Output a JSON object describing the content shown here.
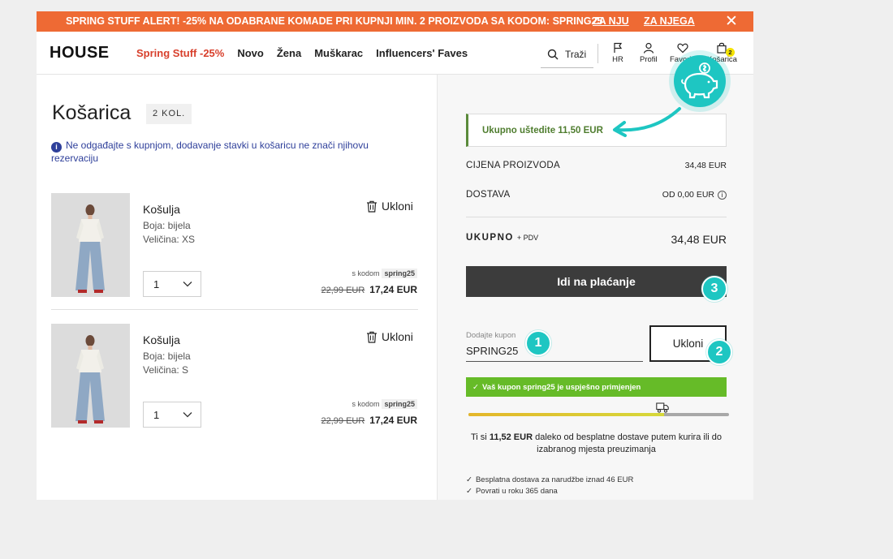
{
  "promo": {
    "text": "SPRING STUFF ALERT! -25% NA ODABRANE KOMADE PRI KUPNJI MIN. 2 PROIZVODA SA KODOM: SPRING25",
    "link_her": "ZA NJU",
    "link_him": "ZA NJEGA",
    "close": "✕"
  },
  "header": {
    "logo": "HOUSE",
    "nav": [
      "Spring Stuff -25%",
      "Novo",
      "Žena",
      "Muškarac",
      "Influencers' Faves"
    ],
    "search_placeholder": "Traži",
    "icons": {
      "lang": "HR",
      "profile": "Profil",
      "favorites": "Favoriti",
      "cart": "Košarica",
      "cart_count": "2"
    }
  },
  "cart": {
    "title": "Košarica",
    "count_badge": "2 KOL.",
    "notice": "Ne odgađajte s kupnjom, dodavanje stavki u košaricu ne znači njihovu rezervaciju",
    "items": [
      {
        "name": "Košulja",
        "color": "Boja: bijela",
        "size": "Veličina: XS",
        "qty": "1",
        "remove": "Ukloni",
        "code_prefix": "s kodom",
        "code": "spring25",
        "old_price": "22,99 EUR",
        "new_price": "17,24 EUR"
      },
      {
        "name": "Košulja",
        "color": "Boja: bijela",
        "size": "Veličina: S",
        "qty": "1",
        "remove": "Ukloni",
        "code_prefix": "s kodom",
        "code": "spring25",
        "old_price": "22,99 EUR",
        "new_price": "17,24 EUR"
      }
    ]
  },
  "summary": {
    "savings": "Ukupno uštedite 11,50 EUR",
    "product_price_label": "CIJENA PROIZVODA",
    "product_price": "34,48 EUR",
    "delivery_label": "DOSTAVA",
    "delivery": "OD 0,00 EUR",
    "total_label": "UKUPNO",
    "total_suffix": "+ PDV",
    "total": "34,48 EUR",
    "checkout": "Idi na plaćanje",
    "coupon_label": "Dodajte kupon",
    "coupon_value": "SPRING25",
    "coupon_remove": "Ukloni",
    "coupon_success": "Vaš kupon spring25 je uspješno primjenjen",
    "shipping_progress": 0.75,
    "shipping_msg_prefix": "Ti si",
    "shipping_msg_amount": "11,52 EUR",
    "shipping_msg_rest": "daleko od besplatne dostave putem kurira ili do izabranog mjesta preuzimanja",
    "bullets": [
      "Besplatna dostava za narudžbe iznad 46 EUR",
      "Povrati u roku 365 dana"
    ]
  },
  "annotations": [
    "1",
    "2",
    "3"
  ],
  "colors": {
    "promo": "#ee6a34",
    "accent": "#1ec6c2",
    "success": "#66bb28",
    "checkout": "#3c3c3c",
    "savings_text": "#4f7d2f"
  }
}
